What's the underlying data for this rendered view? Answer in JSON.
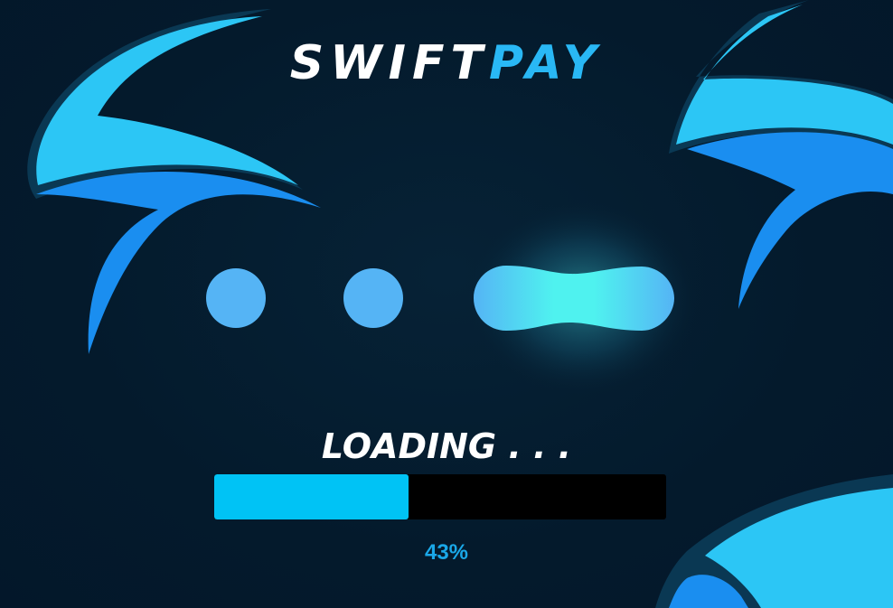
{
  "app": {
    "logo": {
      "part1": "SWIFT",
      "part2": "PAY",
      "part1_color": "#ffffff",
      "part2_color": "#29b8f5"
    }
  },
  "loader": {
    "label": "LOADING . . .",
    "progress": {
      "value": 43,
      "text": "43%"
    },
    "colors": {
      "dot": "#55b4f5",
      "glow": "#4ff2ef",
      "fill": "#00c3f5",
      "track": "#000000",
      "background": "#041a2c"
    }
  }
}
